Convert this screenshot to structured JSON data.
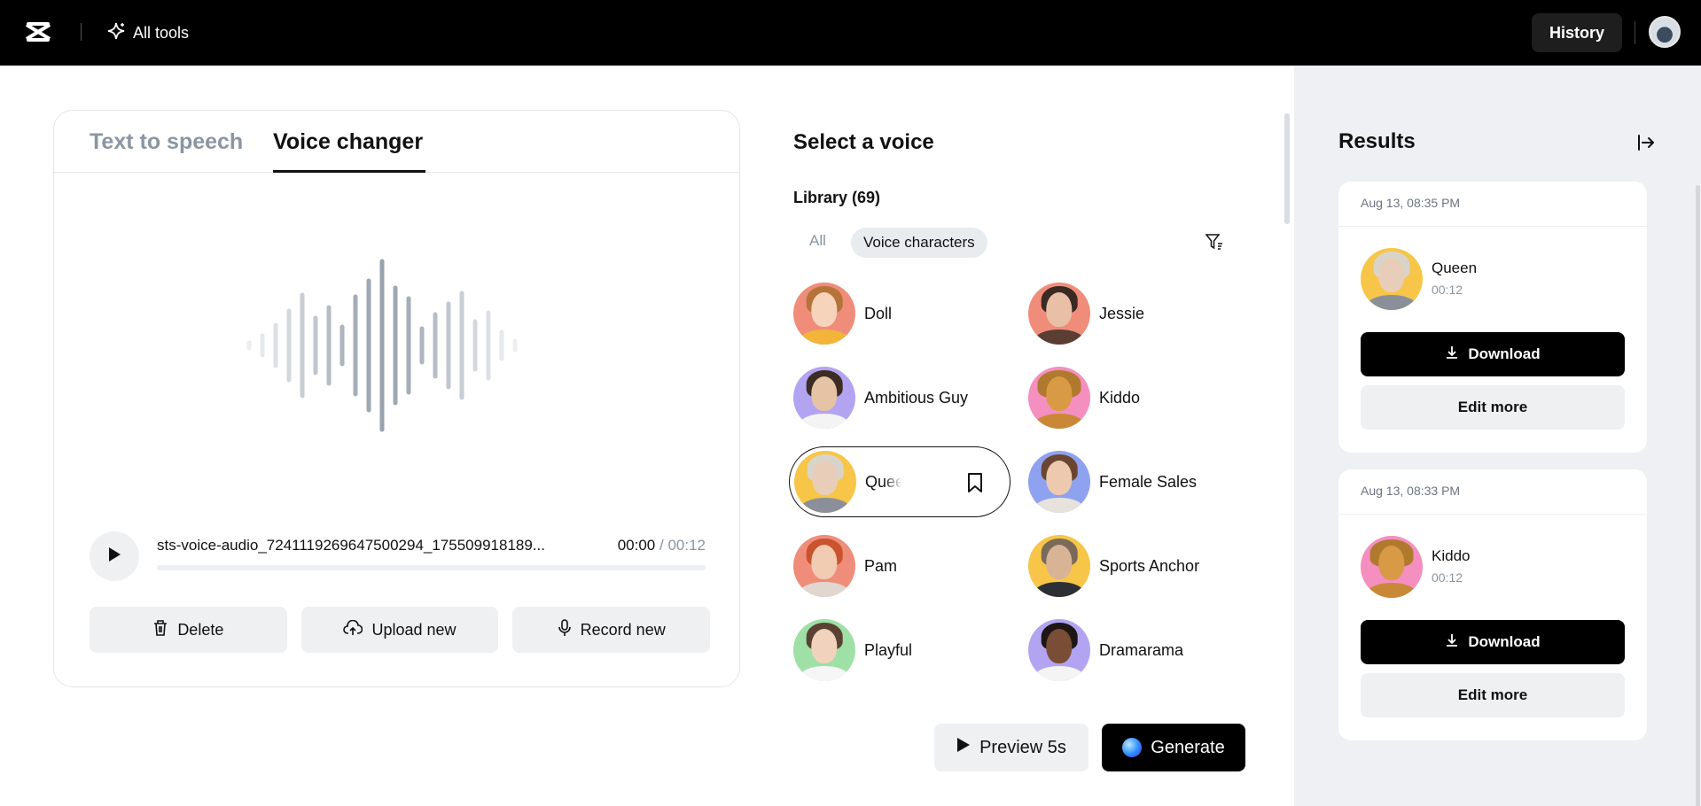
{
  "topbar": {
    "all_tools_label": "All tools",
    "history_label": "History"
  },
  "editor": {
    "tabs": [
      {
        "label": "Text to speech",
        "active": false
      },
      {
        "label": "Voice changer",
        "active": true
      }
    ],
    "player": {
      "file_name": "sts-voice-audio_7241119269647500294_175509918189...",
      "current_time": "00:00",
      "separator": "/",
      "total_time": "00:12",
      "progress": 0
    },
    "actions": {
      "delete_label": "Delete",
      "upload_label": "Upload new",
      "record_label": "Record new"
    }
  },
  "voices": {
    "title": "Select a voice",
    "library_label": "Library (69)",
    "filters": {
      "all": "All",
      "voice_characters": "Voice characters"
    },
    "selected": "Queen",
    "items": [
      {
        "name": "Doll",
        "bg": "#f08d7a"
      },
      {
        "name": "Jessie",
        "bg": "#f08d7a"
      },
      {
        "name": "Ambitious Guy",
        "bg": "#b3a4f2"
      },
      {
        "name": "Kiddo",
        "bg": "#f48fc0"
      },
      {
        "name": "Queen",
        "bg": "#f7c648"
      },
      {
        "name": "Female Sales",
        "bg": "#8fa2f0"
      },
      {
        "name": "Pam",
        "bg": "#f08d7a"
      },
      {
        "name": "Sports Anchor",
        "bg": "#f7c648"
      },
      {
        "name": "Playful",
        "bg": "#9fe0a6"
      },
      {
        "name": "Dramarama",
        "bg": "#b3a4f2"
      }
    ],
    "preview_label": "Preview 5s",
    "generate_label": "Generate"
  },
  "results": {
    "title": "Results",
    "items": [
      {
        "date": "Aug 13, 08:35 PM",
        "name": "Queen",
        "duration": "00:12",
        "download_label": "Download",
        "edit_label": "Edit more"
      },
      {
        "date": "Aug 13, 08:33 PM",
        "name": "Kiddo",
        "duration": "00:12",
        "download_label": "Download",
        "edit_label": "Edit more"
      }
    ]
  },
  "icons": {
    "logo": "capcut-logo-icon",
    "all_tools": "sparkle-icon",
    "play": "play-icon",
    "delete": "trash-icon",
    "upload": "cloud-upload-icon",
    "record": "microphone-icon",
    "filter": "filter-icon",
    "bookmark": "bookmark-icon",
    "collapse": "collapse-panel-icon",
    "download": "download-icon"
  }
}
